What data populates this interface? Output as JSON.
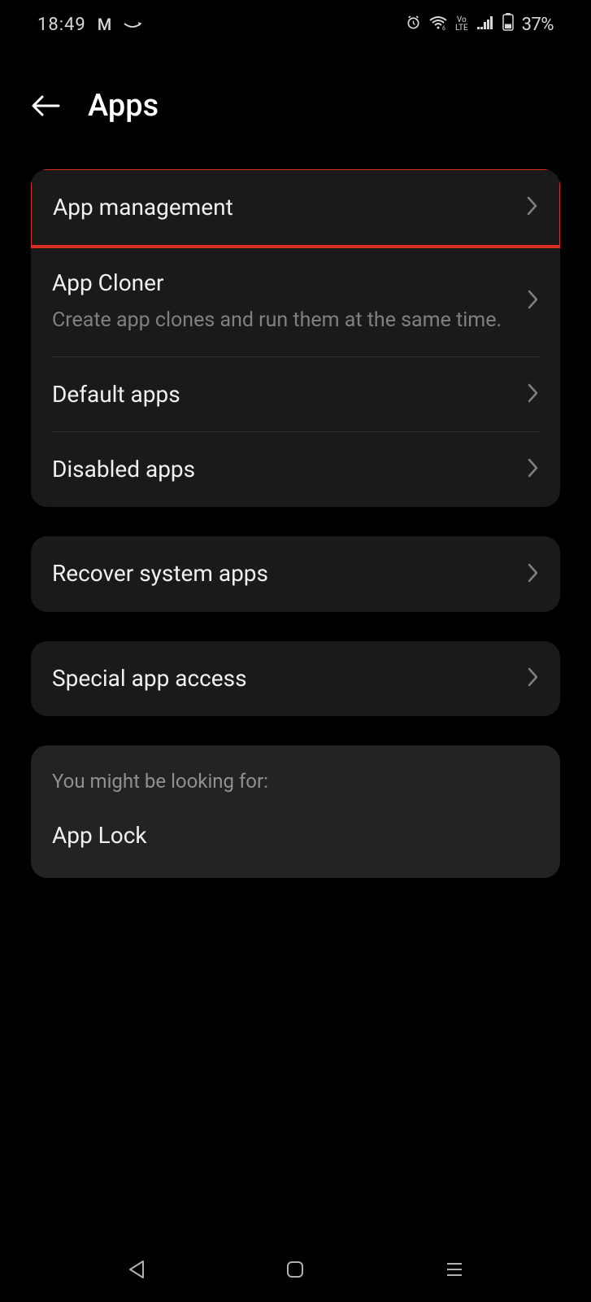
{
  "statusBar": {
    "time": "18:49",
    "batteryPercent": "37%"
  },
  "header": {
    "title": "Apps"
  },
  "groups": [
    {
      "items": [
        {
          "title": "App management",
          "subtitle": "",
          "highlighted": true
        },
        {
          "title": "App Cloner",
          "subtitle": "Create app clones and run them at the same time."
        },
        {
          "title": "Default apps",
          "subtitle": ""
        },
        {
          "title": "Disabled apps",
          "subtitle": ""
        }
      ]
    },
    {
      "items": [
        {
          "title": "Recover system apps",
          "subtitle": ""
        }
      ]
    },
    {
      "items": [
        {
          "title": "Special app access",
          "subtitle": ""
        }
      ]
    }
  ],
  "suggestion": {
    "header": "You might be looking for:",
    "link": "App Lock"
  }
}
